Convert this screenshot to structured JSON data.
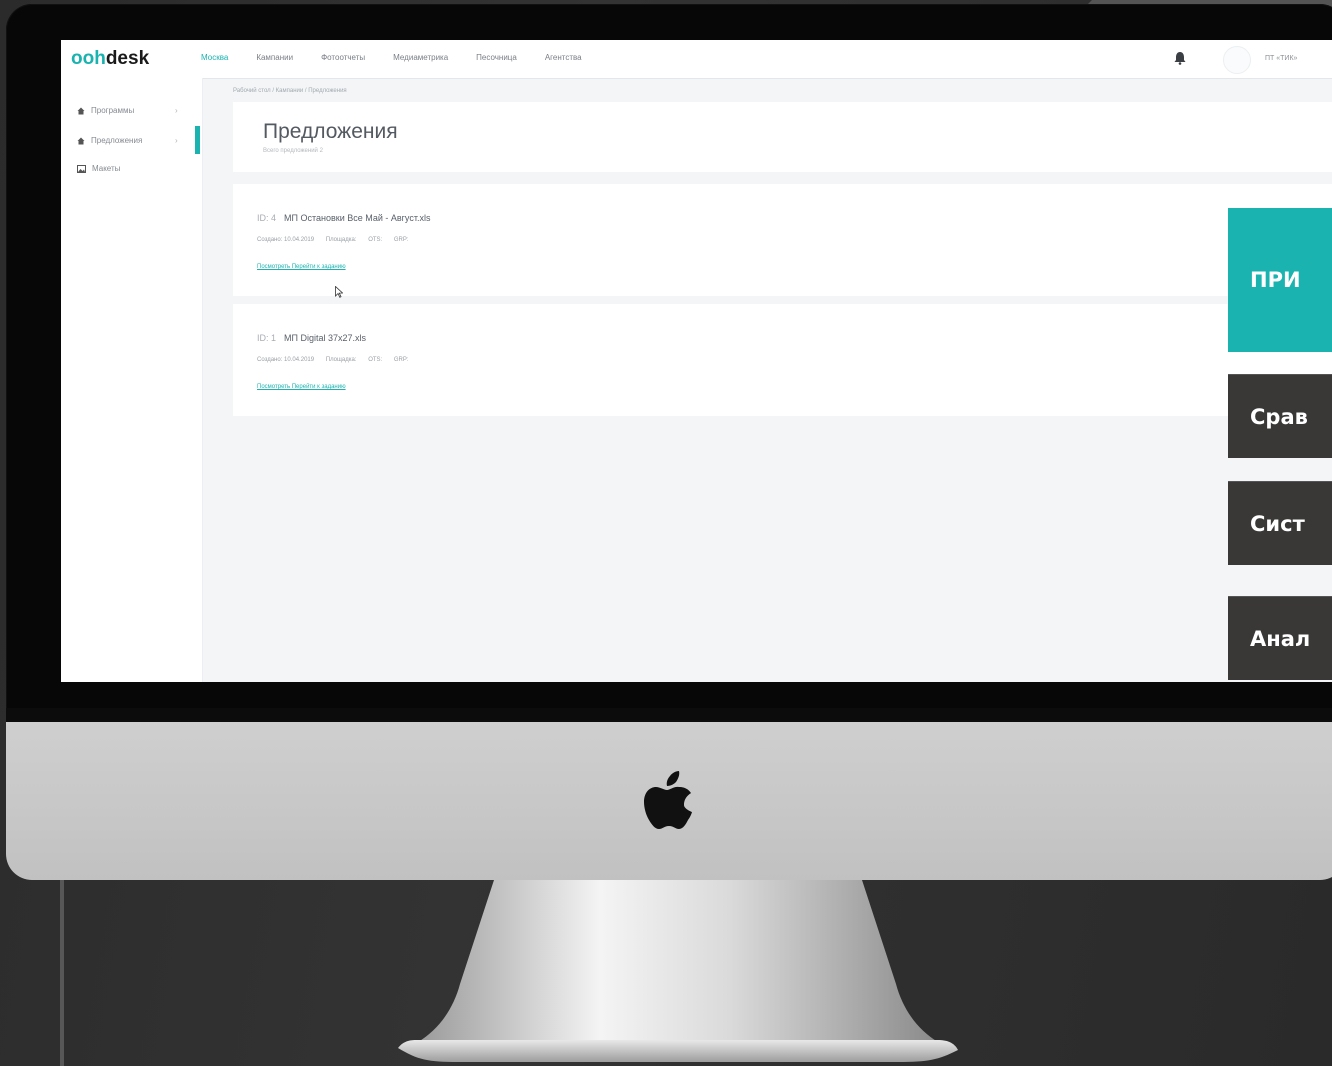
{
  "app": {
    "logo_prefix": "ooh",
    "logo_suffix": "desk",
    "nav": [
      "Москва",
      "Кампании",
      "Фотоотчеты",
      "Медиаметрика",
      "Песочница",
      "Агентства"
    ],
    "active_nav": "Москва",
    "user_label": "ПТ «ТИК»"
  },
  "sidebar": {
    "items": [
      {
        "label": "Программы",
        "icon": "home-icon"
      },
      {
        "label": "Предложения",
        "icon": "home-icon"
      },
      {
        "label": "Макеты",
        "icon": "image-icon"
      }
    ]
  },
  "breadcrumb": "Рабочий стол  /  Кампании  /  Предложения",
  "page": {
    "title": "Предложения",
    "subtitle": "Всего предложений 2"
  },
  "proposals": [
    {
      "id": "ID: 4",
      "name": "МП Остановки Все Май - Август.xls",
      "created": "Создано: 10.04.2019",
      "area": "Площадка:",
      "ots": "OTS:",
      "grp": "GRP:",
      "links": "Посмотреть  Перейти к заданию"
    },
    {
      "id": "ID: 1",
      "name": "МП Digital 37x27.xls",
      "created": "Создано: 10.04.2019",
      "area": "Площадка:",
      "ots": "OTS:",
      "grp": "GRP:",
      "links": "Посмотреть  Перейти к заданию"
    }
  ],
  "overlay": {
    "primary": "ПРИ",
    "items": [
      "Срав",
      "Сист",
      "Анал"
    ],
    "primary_color": "#1ab3b0",
    "dark_color": "#3a3837"
  }
}
